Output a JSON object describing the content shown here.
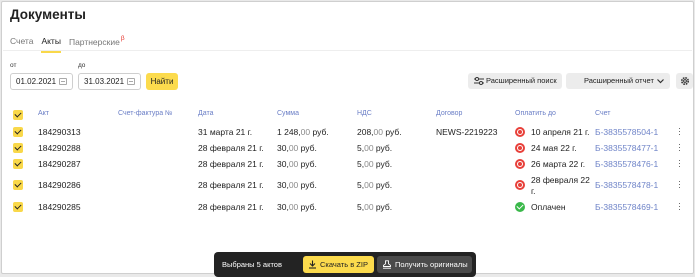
{
  "page": {
    "title": "Документы"
  },
  "tabs": [
    {
      "label": "Счета"
    },
    {
      "label": "Акты"
    },
    {
      "label": "Партнерские",
      "badge": "β"
    }
  ],
  "filters": {
    "from_label": "от",
    "to_label": "до",
    "from_value": "01.02.2021",
    "to_value": "31.03.2021",
    "find_label": "Найти",
    "advanced_search_label": "Расширенный поиск",
    "advanced_report_label": "Расширенный отчет"
  },
  "table": {
    "columns": [
      "Акт",
      "Счет-фактура №",
      "Дата",
      "Сумма",
      "НДС",
      "Договор",
      "Оплатить до",
      "Счет"
    ],
    "rows": [
      {
        "act": "184290313",
        "invoice": "",
        "date": "31 марта 21 г.",
        "sum_main": "1 248,",
        "sum_cents": "00",
        "sum_cur": " руб.",
        "vat_main": "208,",
        "vat_cents": "00",
        "vat_cur": " руб.",
        "contract": "NEWS-2219223",
        "pay_until": "10 апреля 21 г.",
        "status": "red",
        "account": "Б-3835578504-1"
      },
      {
        "act": "184290288",
        "invoice": "",
        "date": "28 февраля 21 г.",
        "sum_main": "30,",
        "sum_cents": "00",
        "sum_cur": " руб.",
        "vat_main": "5,",
        "vat_cents": "00",
        "vat_cur": " руб.",
        "contract": "",
        "pay_until": "24 мая 22 г.",
        "status": "red",
        "account": "Б-3835578477-1"
      },
      {
        "act": "184290287",
        "invoice": "",
        "date": "28 февраля 21 г.",
        "sum_main": "30,",
        "sum_cents": "00",
        "sum_cur": " руб.",
        "vat_main": "5,",
        "vat_cents": "00",
        "vat_cur": " руб.",
        "contract": "",
        "pay_until": "26 марта 22 г.",
        "status": "red",
        "account": "Б-3835578476-1"
      },
      {
        "act": "184290286",
        "invoice": "",
        "date": "28 февраля 21 г.",
        "sum_main": "30,",
        "sum_cents": "00",
        "sum_cur": " руб.",
        "vat_main": "5,",
        "vat_cents": "00",
        "vat_cur": " руб.",
        "contract": "",
        "pay_until_1": "28 февраля 22",
        "pay_until_2": "г.",
        "status": "red",
        "account": "Б-3835578478-1"
      },
      {
        "act": "184290285",
        "invoice": "",
        "date": "28 февраля 21 г.",
        "sum_main": "30,",
        "sum_cents": "00",
        "sum_cur": " руб.",
        "vat_main": "5,",
        "vat_cents": "00",
        "vat_cur": " руб.",
        "contract": "",
        "pay_until": "Оплачен",
        "status": "green",
        "account": "Б-3835578469-1"
      }
    ]
  },
  "selection_bar": {
    "selected_label": "Выбраны 5 актов",
    "download_label": "Скачать в ZIP",
    "originals_label": "Получить оригиналы"
  },
  "colors": {
    "accent": "#fcdb4d",
    "link": "#6f84c8",
    "overdue": "#e8403a",
    "paid": "#3ab84a"
  }
}
